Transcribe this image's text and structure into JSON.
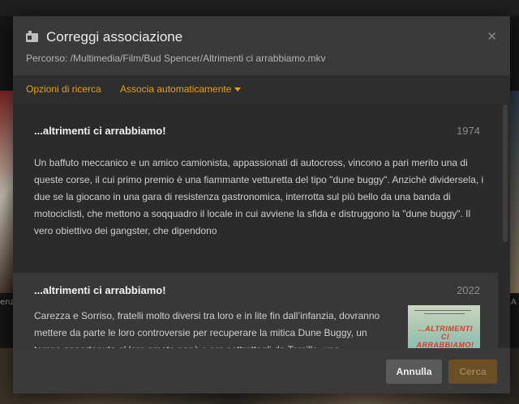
{
  "dialog": {
    "title": "Correggi associazione",
    "icon": "id-card-icon",
    "close_glyph": "✕",
    "path": "Percorso: /Multimedia/Film/Bud Spencer/Altrimenti ci arrabbiamo.mkv"
  },
  "tabs": {
    "search_options": "Opzioni di ricerca",
    "auto_match": "Associa automaticamente"
  },
  "results": [
    {
      "title": "...altrimenti ci arrabbiamo!",
      "year": "1974",
      "summary": "Un baffuto meccanico e un amico camionista, appassionati di autocross, vincono a pari merito una di queste corse, il cui primo premio è una fiammante vetturetta del tipo \"dune buggy\". Anzichè dividersela, i due se la giocano in una gara di resistenza gastronomica, interrotta sul più bello da una banda di motociclisti, che mettono a soqquadro il locale in cui avviene la sfida e distruggono la \"dune buggy\". Il vero obiettivo dei gangster, che dipendono"
    },
    {
      "title": "...altrimenti ci arrabbiamo!",
      "year": "2022",
      "summary": "Carezza e Sorriso, fratelli molto diversi tra loro e in lite fin dall’infanzia, dovranno mettere da parte le loro controversie per recuperare la mitica Dune Buggy, un tempo appartenuta al loro amato papà e ora sottrattagli da Torsillo, uno speculatore edilizio senza scrupoli, e da suo figlio Paniero. Nel farlo,",
      "poster_text": "...ALTRIMENTI CI ARRABBIAMO!"
    }
  ],
  "background": {
    "left_label": "enzo",
    "right_label": "A"
  },
  "footer": {
    "cancel_label": "Annulla",
    "search_label": "Cerca"
  },
  "colors": {
    "accent": "#e5a00d",
    "modal_bg": "#3a3a3a",
    "results_bg": "#2b2b2b"
  }
}
